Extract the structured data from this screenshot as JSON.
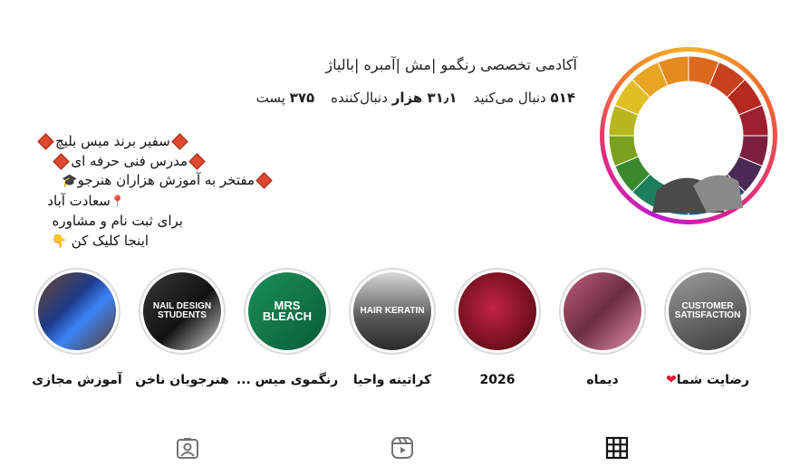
{
  "profile": {
    "title": "آکادمی تخصصی رنگمو |مش |آمبره |بالیاژ",
    "stats": {
      "posts_value": "۳۷۵",
      "posts_label": "پست",
      "followers_value": "۳۱٫۱ هزار",
      "followers_label": "دنبال‌کننده",
      "following_value": "۵۱۴",
      "following_label": "دنبال می‌کنید"
    },
    "bio": {
      "line1": "سفیر برند میس بلیچ",
      "line2": "مدرس فنی حرفه ای",
      "line3": "مفتخر به آموزش هزاران هنرجو",
      "line4": "سعادت آباد",
      "line5": "برای ثبت نام و مشاوره",
      "line6": "اینجا کلیک کن"
    }
  },
  "highlights": [
    {
      "label": "رضایت شما",
      "cover_text": "CUSTOMER SATISFACTION"
    },
    {
      "label": "دیماه",
      "cover_text": ""
    },
    {
      "label": "2026",
      "cover_text": ""
    },
    {
      "label": "کراتینه واحیا",
      "cover_text": "HAIR KERATIN"
    },
    {
      "label": "رنگموی میس ...",
      "cover_text": "MRS BLEACH"
    },
    {
      "label": "هنرجویان ناخن",
      "cover_text": "NAIL DESIGN STUDENTS"
    },
    {
      "label": "آموزش مجازی",
      "cover_text": ""
    }
  ],
  "tabs": [
    {
      "name": "posts",
      "icon": "grid-icon"
    },
    {
      "name": "reels",
      "icon": "reels-icon"
    },
    {
      "name": "tagged",
      "icon": "tagged-user-icon"
    }
  ]
}
